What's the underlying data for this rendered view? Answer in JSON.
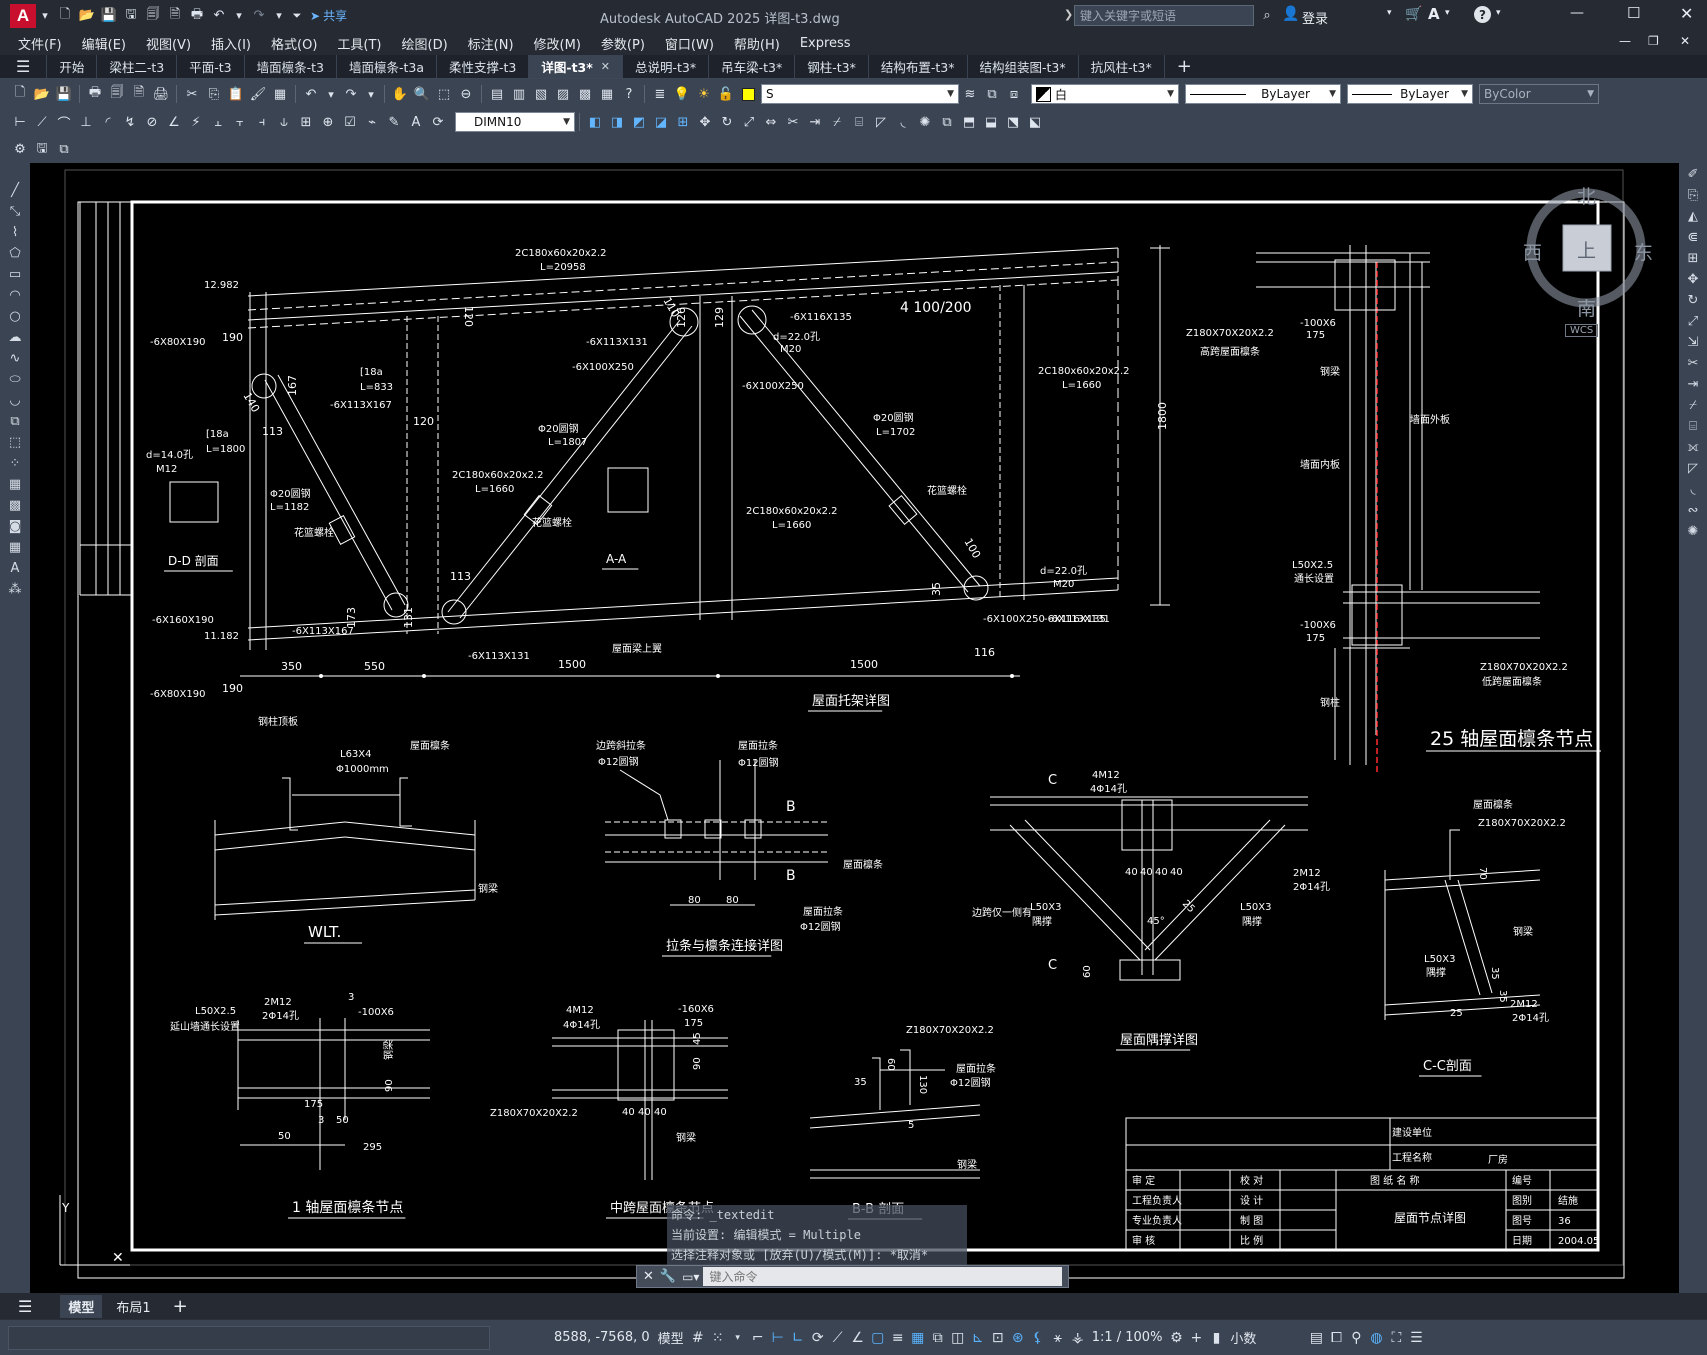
{
  "app": {
    "title": "Autodesk AutoCAD 2025    详图-t3.dwg",
    "search_placeholder": "键入关键字或短语",
    "login": "登录",
    "share": "共享",
    "logo": "A"
  },
  "menu": [
    "文件(F)",
    "编辑(E)",
    "视图(V)",
    "插入(I)",
    "格式(O)",
    "工具(T)",
    "绘图(D)",
    "标注(N)",
    "修改(M)",
    "参数(P)",
    "窗口(W)",
    "帮助(H)",
    "Express"
  ],
  "tabs": [
    {
      "label": "开始"
    },
    {
      "label": "梁柱二-t3"
    },
    {
      "label": "平面-t3"
    },
    {
      "label": "墙面檩条-t3"
    },
    {
      "label": "墙面檩条-t3a"
    },
    {
      "label": "柔性支撑-t3"
    },
    {
      "label": "详图-t3*",
      "active": true
    },
    {
      "label": "总说明-t3*"
    },
    {
      "label": "吊车梁-t3*"
    },
    {
      "label": "钢柱-t3*"
    },
    {
      "label": "结构布置-t3*"
    },
    {
      "label": "结构组装图-t3*"
    },
    {
      "label": "抗风柱-t3*"
    }
  ],
  "toolbar": {
    "layer": "S",
    "color": "白",
    "linetype": "ByLayer",
    "lineweight": "ByLayer",
    "plotstyle": "ByColor",
    "dimstyle": "DIMN10"
  },
  "viewcube": {
    "north": "北",
    "south": "南",
    "east": "东",
    "west": "西",
    "top": "上",
    "wcs": "WCS"
  },
  "command": {
    "history": [
      "命令: _textedit",
      "当前设置: 编辑模式 = Multiple",
      "选择注释对象或 [放弃(U)/模式(M)]: *取消*"
    ],
    "placeholder": "键入命令"
  },
  "layout_tabs": [
    {
      "label": "模型",
      "active": true
    },
    {
      "label": "布局1"
    }
  ],
  "status": {
    "coords": "8588, -7568, 0",
    "model": "模型",
    "scale": "1:1 / 100%",
    "units": "小数"
  },
  "drawing": {
    "titles": {
      "truss": "屋面托架详图",
      "node25": "25 轴屋面檩条节点",
      "wlt": "WLT.",
      "tie": "拉条与檩条连接详图",
      "brace": "屋面隅撑详图",
      "cc": "C-C剖面",
      "node1": "1 轴屋面檩条节点",
      "mid": "中跨屋面檩条节点",
      "bb": "B-B 剖面",
      "dd": "D-D 剖面",
      "aa": "A-A"
    },
    "truss_labels": [
      "2C180x60x20x2.2",
      "L=20958",
      "2C180x60x20x2.2",
      "L=1660",
      "2C180x60x20x2.2",
      "L=1660",
      "2C180x60x20x2.2",
      "L=1660",
      "Φ20圆钢",
      "L=1807",
      "Φ20圆钢",
      "L=1702",
      "Φ20圆钢",
      "L=1182",
      "-6X113X131",
      "-6X100X250",
      "-6X116X135",
      "-6X100X250",
      "-6X113X167",
      "-6X80X190",
      "-6X160X190",
      "-6X80X190",
      "-6X113X167",
      "-6X113X131",
      "-6X100X250",
      "-6X116X135",
      "-6X113X131",
      "d=22.0孔",
      "M20",
      "d=22.0孔",
      "M20",
      "d=14.0孔",
      "M12",
      "[18a",
      "L=833",
      "[18a",
      "L=1800",
      "12.982",
      "11.182",
      "4 100/200",
      "花篮螺栓",
      "花篮螺栓",
      "花篮螺栓",
      "屋面梁上翼",
      "钢柱顶板"
    ],
    "truss_dims": [
      "350",
      "550",
      "1500",
      "1500",
      "1800",
      "190",
      "190",
      "120",
      "120",
      "113",
      "113",
      "126",
      "129",
      "110",
      "140",
      "167",
      "173",
      "131",
      "116",
      "100",
      "35"
    ],
    "node25_labels": [
      "Z180X70X20X2.2",
      "高跨屋面檩条",
      "-100X6",
      "175",
      "钢梁",
      "墙面外板",
      "墙面内板",
      "L50X2.5",
      "通长设置",
      "-100X6",
      "175",
      "Z180X70X20X2.2",
      "低跨屋面檩条",
      "钢柱"
    ],
    "wlt_labels": [
      "L63X4",
      "Φ1000mm",
      "屋面檩条",
      "钢梁"
    ],
    "tie_labels": [
      "边跨斜拉条",
      "Φ12圆钢",
      "屋面拉条",
      "Φ12圆钢",
      "屋面檩条",
      "屋面拉条",
      "Φ12圆钢",
      "80",
      "80",
      "B",
      "B"
    ],
    "brace_labels": [
      "4M12",
      "4Φ14孔",
      "L50X3",
      "隅撑",
      "L50X3",
      "隅撑",
      "2M12",
      "2Φ14孔",
      "边跨仅一侧有",
      "40",
      "40",
      "40",
      "40",
      "45°",
      "25",
      "60",
      "C",
      "C"
    ],
    "cc_labels": [
      "屋面檩条",
      "Z180X70X20X2.2",
      "钢梁",
      "L50X3",
      "隅撑",
      "2M12",
      "2Φ14孔",
      "70",
      "35",
      "35",
      "25"
    ],
    "node1_labels": [
      "L50X2.5",
      "延山墙通长设置",
      "2M12",
      "2Φ14孔",
      "3",
      "-100X6",
      "175",
      "3",
      "50",
      "50",
      "295",
      "钢梁",
      "90",
      "90"
    ],
    "mid_labels": [
      "4M12",
      "4Φ14孔",
      "-160X6",
      "175",
      "Z180X70X20X2.2",
      "钢梁",
      "40",
      "40",
      "40",
      "90",
      "45"
    ],
    "bb_labels": [
      "Z180X70X20X2.2",
      "屋面拉条",
      "Φ12圆钢",
      "钢梁",
      "60",
      "130",
      "35",
      "5"
    ],
    "titleblock": {
      "build_unit_label": "建设单位",
      "project_label": "工程名称",
      "project": "厂房",
      "rows_left": [
        "审 定",
        "工程负责人",
        "专业负责人",
        "审 核"
      ],
      "rows_mid": [
        "校 对",
        "设 计",
        "制 图",
        "比 例"
      ],
      "drawing_name_label": "图 纸 名 称",
      "drawing_name": "屋面节点详图",
      "right_labels": [
        "编号",
        "图别",
        "图号",
        "日期"
      ],
      "right_values": [
        "",
        "结施",
        "36",
        "2004.05"
      ]
    }
  }
}
